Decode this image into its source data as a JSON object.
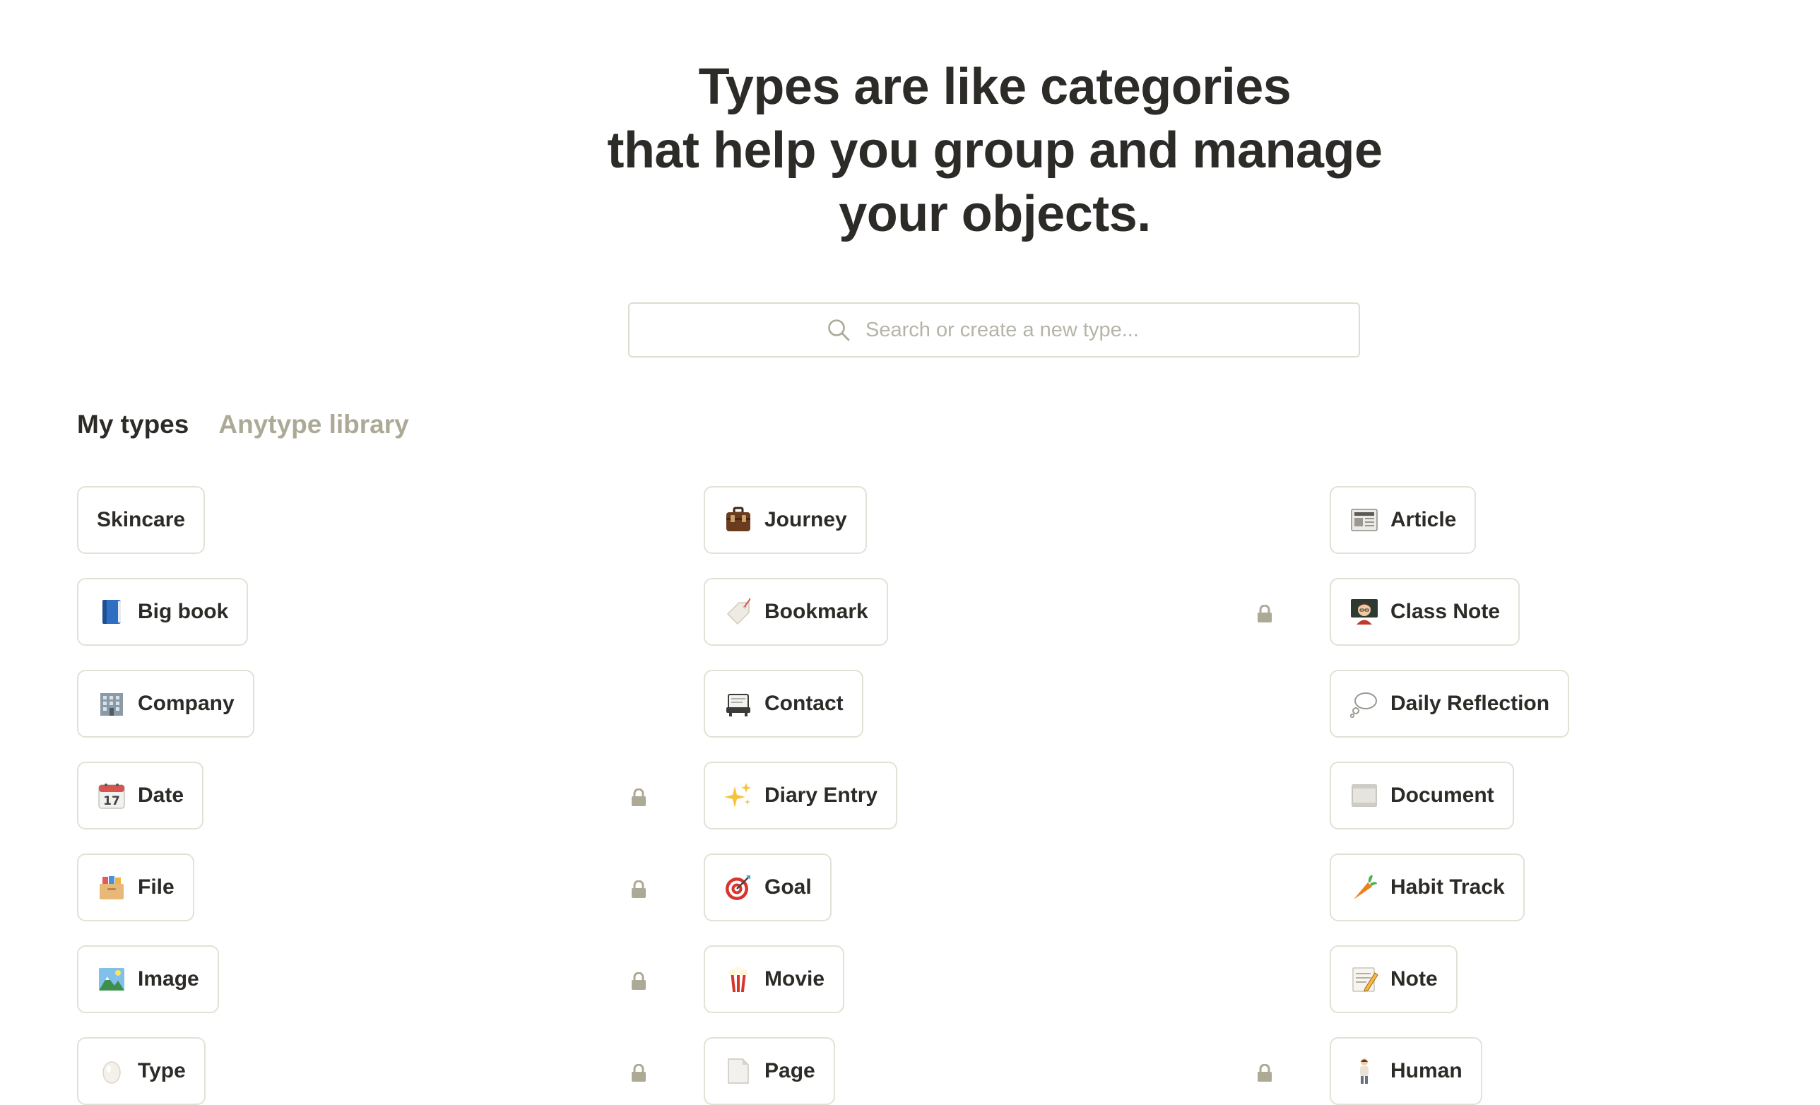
{
  "headline": {
    "line1": "Types are like categories",
    "line2": "that help you group and manage",
    "line3": "your objects."
  },
  "search": {
    "placeholder": "Search or create a new type..."
  },
  "tabs": {
    "my_types": "My types",
    "library": "Anytype library"
  },
  "types": [
    {
      "label": "Skincare",
      "icon": "none"
    },
    {
      "label": "Big book",
      "icon": "blue-book-icon"
    },
    {
      "label": "Company",
      "icon": "office-building-icon"
    },
    {
      "label": "Date",
      "icon": "calendar-icon",
      "locked": true
    },
    {
      "label": "File",
      "icon": "file-box-icon",
      "locked": true
    },
    {
      "label": "Image",
      "icon": "landscape-image-icon",
      "locked": true
    },
    {
      "label": "Type",
      "icon": "egg-icon",
      "locked": true
    },
    {
      "label": "Journey",
      "icon": "suitcase-icon"
    },
    {
      "label": "Bookmark",
      "icon": "tag-icon",
      "locked": true
    },
    {
      "label": "Contact",
      "icon": "rolodex-icon"
    },
    {
      "label": "Diary Entry",
      "icon": "sparkles-icon"
    },
    {
      "label": "Goal",
      "icon": "target-icon"
    },
    {
      "label": "Movie",
      "icon": "popcorn-icon"
    },
    {
      "label": "Page",
      "icon": "page-icon",
      "locked": true
    },
    {
      "label": "Article",
      "icon": "newspaper-icon"
    },
    {
      "label": "Class Note",
      "icon": "teacher-icon"
    },
    {
      "label": "Daily Reflection",
      "icon": "thought-bubble-icon"
    },
    {
      "label": "Document",
      "icon": "document-icon"
    },
    {
      "label": "Habit Track",
      "icon": "carrot-icon"
    },
    {
      "label": "Note",
      "icon": "memo-icon"
    },
    {
      "label": "Human",
      "icon": "person-icon"
    }
  ],
  "colors": {
    "text": "#2c2b27",
    "muted_tab": "#aca996",
    "chip_border": "#e3e1d6",
    "lock": "#aca996",
    "placeholder": "#b6b4a8"
  }
}
